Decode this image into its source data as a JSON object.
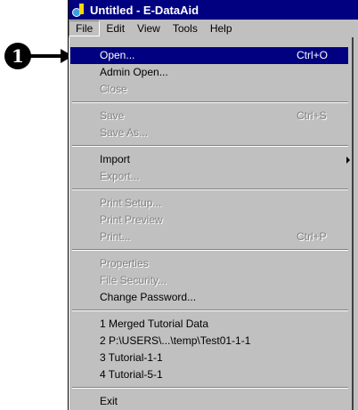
{
  "window": {
    "title": "Untitled - E-DataAid"
  },
  "callout": {
    "number": "1"
  },
  "menubar": [
    "File",
    "Edit",
    "View",
    "Tools",
    "Help"
  ],
  "file_menu": {
    "items": [
      {
        "label": "Open...",
        "shortcut": "Ctrl+O",
        "state": "highlighted"
      },
      {
        "label": "Admin Open...",
        "shortcut": "",
        "state": "enabled"
      },
      {
        "label": "Close",
        "shortcut": "",
        "state": "disabled"
      },
      {
        "label": "Save",
        "shortcut": "Ctrl+S",
        "state": "disabled"
      },
      {
        "label": "Save As...",
        "shortcut": "",
        "state": "disabled"
      },
      {
        "label": "Import",
        "shortcut": "",
        "state": "enabled",
        "submenu": true
      },
      {
        "label": "Export...",
        "shortcut": "",
        "state": "disabled"
      },
      {
        "label": "Print Setup...",
        "shortcut": "",
        "state": "disabled"
      },
      {
        "label": "Print Preview",
        "shortcut": "",
        "state": "disabled"
      },
      {
        "label": "Print...",
        "shortcut": "Ctrl+P",
        "state": "disabled"
      },
      {
        "label": "Properties",
        "shortcut": "",
        "state": "disabled"
      },
      {
        "label": "File Security...",
        "shortcut": "",
        "state": "disabled"
      },
      {
        "label": "Change Password...",
        "shortcut": "",
        "state": "enabled"
      },
      {
        "label": "1 Merged Tutorial Data",
        "shortcut": "",
        "state": "enabled"
      },
      {
        "label": "2 P:\\USERS\\...\\temp\\Test01-1-1",
        "shortcut": "",
        "state": "enabled"
      },
      {
        "label": "3 Tutorial-1-1",
        "shortcut": "",
        "state": "enabled"
      },
      {
        "label": "4 Tutorial-5-1",
        "shortcut": "",
        "state": "enabled"
      },
      {
        "label": "Exit",
        "shortcut": "",
        "state": "enabled"
      }
    ]
  }
}
